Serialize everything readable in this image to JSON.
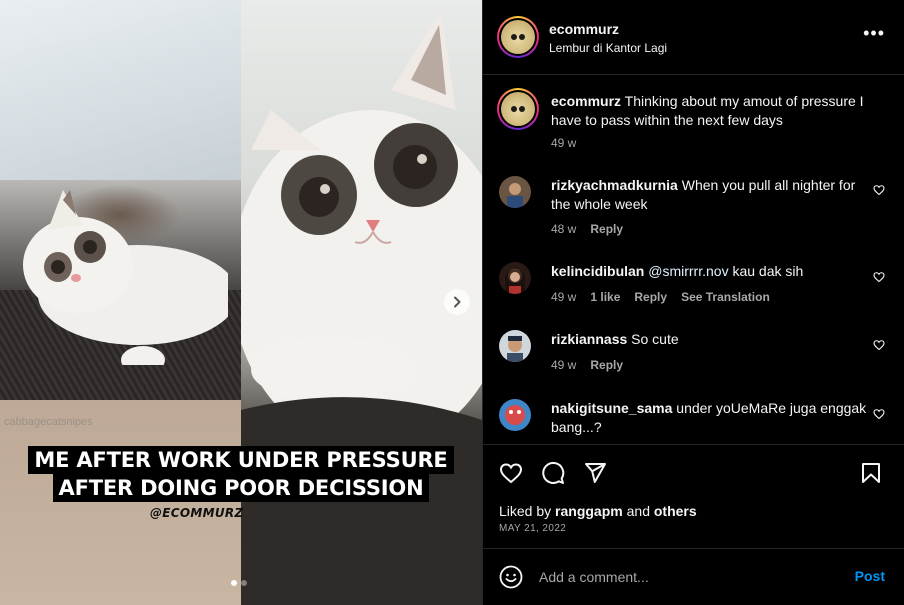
{
  "post": {
    "username": "ecommurz",
    "location": "Lembur di Kantor Lagi",
    "more_icon": "more-horizontal-icon",
    "caption_text": "Thinking about my amout of pressure I have to pass within the next few days",
    "caption_time": "49 w"
  },
  "media": {
    "overlay_line1": "ME AFTER WORK UNDER PRESSURE",
    "overlay_line2": "AFTER DOING POOR DECISSION",
    "watermark": "@ECOMMURZ",
    "faint_text": "cabbagecatsnipes",
    "next_icon": "chevron-right-icon",
    "slide_count": 2,
    "active_slide": 1
  },
  "comments": [
    {
      "username": "rizkyachmadkurnia",
      "text": "When you pull all nighter for the whole week",
      "time": "48 w",
      "likes": "",
      "reply": "Reply",
      "translate": ""
    },
    {
      "username": "kelincidibulan",
      "mention": "@smirrrr.nov",
      "text": "kau dak sih",
      "time": "49 w",
      "likes": "1 like",
      "reply": "Reply",
      "translate": "See Translation"
    },
    {
      "username": "rizkiannass",
      "text": "So cute",
      "time": "49 w",
      "likes": "",
      "reply": "Reply",
      "translate": ""
    },
    {
      "username": "nakigitsune_sama",
      "text": "under yoUeMaRe juga enggak bang...?",
      "time": "",
      "likes": "",
      "reply": "",
      "translate": ""
    }
  ],
  "actions": {
    "like_icon": "heart-icon",
    "comment_icon": "comment-icon",
    "share_icon": "send-icon",
    "save_icon": "bookmark-icon",
    "liked_prefix": "Liked by",
    "liked_user": "ranggapm",
    "liked_and": "and",
    "liked_others": "others",
    "date": "MAY 21, 2022"
  },
  "add_comment": {
    "emoji_icon": "emoji-icon",
    "placeholder": "Add a comment...",
    "post_label": "Post"
  },
  "colors": {
    "background": "#000000",
    "text": "#f5f5f5",
    "muted": "#a8a8a8",
    "accent": "#0095f6",
    "divider": "#262626"
  }
}
